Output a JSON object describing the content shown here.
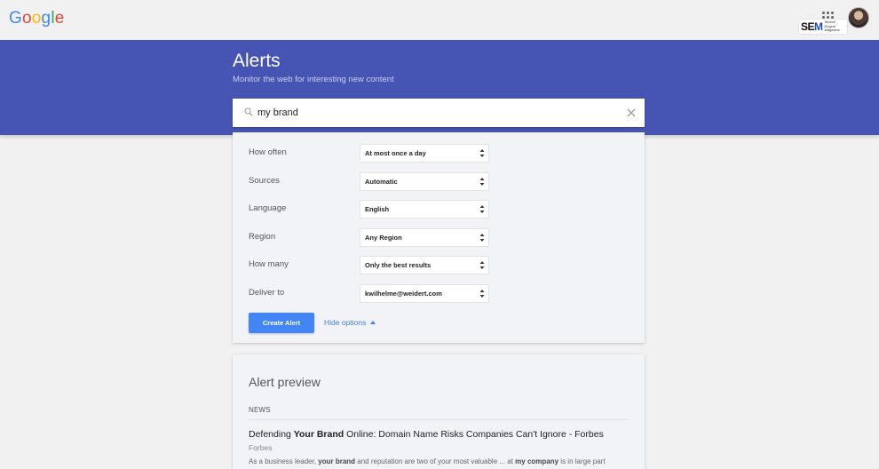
{
  "header": {
    "logo_letters": [
      {
        "ch": "G",
        "color": "#4285f4"
      },
      {
        "ch": "o",
        "color": "#ea4335"
      },
      {
        "ch": "o",
        "color": "#fbbc05"
      },
      {
        "ch": "g",
        "color": "#4285f4"
      },
      {
        "ch": "l",
        "color": "#34a853"
      },
      {
        "ch": "e",
        "color": "#ea4335"
      }
    ],
    "apps_icon": "apps-grid-icon",
    "watermark": {
      "text1": "SE",
      "text2": "M",
      "text3": "Search Engine Magazine"
    }
  },
  "hero": {
    "title": "Alerts",
    "subtitle": "Monitor the web for interesting new content",
    "color": "#4654b3"
  },
  "search": {
    "value": "my brand",
    "search_icon": "search-icon",
    "clear_icon": "close-icon"
  },
  "options": [
    {
      "label": "How often",
      "value": "At most once a day"
    },
    {
      "label": "Sources",
      "value": "Automatic"
    },
    {
      "label": "Language",
      "value": "English"
    },
    {
      "label": "Region",
      "value": "Any Region"
    },
    {
      "label": "How many",
      "value": "Only the best results"
    },
    {
      "label": "Deliver to",
      "value": "kwilhelme@weidert.com"
    }
  ],
  "actions": {
    "create_label": "Create Alert",
    "hide_label": "Hide options",
    "accent": "#4285f4"
  },
  "preview": {
    "title": "Alert preview",
    "section": "NEWS",
    "result": {
      "title_pre": "Defending ",
      "title_bold": "Your Brand",
      "title_post": " Online: Domain Name Risks Companies Can't Ignore - Forbes",
      "source": "Forbes",
      "snippet_pre": "As a business leader, ",
      "snippet_bold1": "your brand",
      "snippet_mid": " and reputation are two of your most valuable ... at ",
      "snippet_bold2": "my company",
      "snippet_post": " is in large part"
    }
  }
}
